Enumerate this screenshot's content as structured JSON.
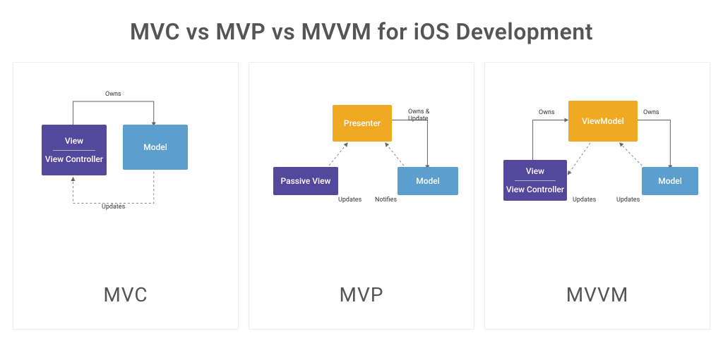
{
  "title": "MVC vs MVP vs MVVM for iOS Development",
  "colors": {
    "purple": "#53489b",
    "blue": "#5c9fcf",
    "yellow": "#efa923"
  },
  "panels": {
    "mvc": {
      "name": "MVC",
      "boxes": {
        "view": "View",
        "viewcontroller": "View Controller",
        "model": "Model"
      },
      "edges": {
        "owns": "Owns",
        "updates": "Updates"
      }
    },
    "mvp": {
      "name": "MVP",
      "boxes": {
        "passiveview": "Passive View",
        "presenter": "Presenter",
        "model": "Model"
      },
      "edges": {
        "ownsupdate": "Owns & Update",
        "updates": "Updates",
        "notifies": "Notifies"
      }
    },
    "mvvm": {
      "name": "MVVM",
      "boxes": {
        "view": "View",
        "viewcontroller": "View Controller",
        "viewmodel": "ViewModel",
        "model": "Model"
      },
      "edges": {
        "owns_left": "Owns",
        "owns_right": "Owns",
        "updates_left": "Updates",
        "updates_right": "Updates"
      }
    }
  }
}
